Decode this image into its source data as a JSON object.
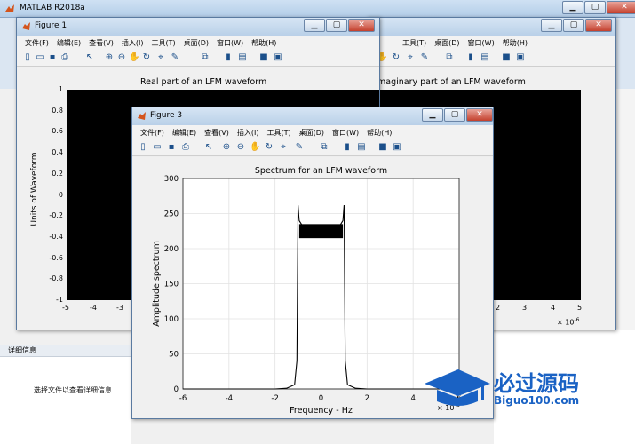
{
  "main": {
    "title": "MATLAB R2018a",
    "detail_header": "详细信息",
    "detail_text": "选择文件以查看详细信息"
  },
  "figures": [
    {
      "title": "Figure 1",
      "menu": [
        "文件(F)",
        "编辑(E)",
        "查看(V)",
        "插入(I)",
        "工具(T)",
        "桌面(D)",
        "窗口(W)",
        "帮助(H)"
      ],
      "plot_title": "Real part of an LFM waveform",
      "ylabel": "Units of Waveform",
      "yticks": [
        "1",
        "0.8",
        "0.6",
        "0.4",
        "0.2",
        "0",
        "-0.2",
        "-0.4",
        "-0.6",
        "-0.8",
        "-1"
      ],
      "xticks": [
        "-5",
        "-4",
        "-3"
      ]
    },
    {
      "title": "Figure 2",
      "menu": [
        "工具(T)",
        "桌面(D)",
        "窗口(W)",
        "帮助(H)"
      ],
      "plot_title": "maginary part of an LFM waveform",
      "xticks": [
        "2",
        "3",
        "4",
        "5"
      ],
      "xexp": "× 10",
      "xexp_power": "-6"
    },
    {
      "title": "Figure 3",
      "menu": [
        "文件(F)",
        "编辑(E)",
        "查看(V)",
        "插入(I)",
        "工具(T)",
        "桌面(D)",
        "窗口(W)",
        "帮助(H)"
      ]
    }
  ],
  "chart_data": {
    "type": "line",
    "title": "Spectrum for an LFM waveform",
    "xlabel": "Frequency - Hz",
    "ylabel": "Amplitude spectrum",
    "x_exponent": "8",
    "xlim": [
      -6,
      6
    ],
    "ylim": [
      0,
      300
    ],
    "xticks": [
      "-6",
      "-4",
      "-2",
      "0",
      "2",
      "4",
      "6"
    ],
    "yticks": [
      "0",
      "50",
      "100",
      "150",
      "200",
      "250",
      "300"
    ],
    "grid": true,
    "series": [
      {
        "x": [
          -6,
          -2,
          -1.5,
          -1.15,
          -1.05,
          -1.0,
          -0.95,
          -0.8,
          -0.5,
          0,
          0.5,
          0.8,
          0.95,
          1.0,
          1.05,
          1.15,
          1.5,
          2,
          6
        ],
        "values": [
          0,
          0,
          1,
          6,
          40,
          262,
          240,
          232,
          226,
          224,
          226,
          232,
          240,
          262,
          40,
          6,
          1,
          0,
          0
        ]
      }
    ],
    "band": {
      "x_range": [
        -0.95,
        0.95
      ],
      "lower": 215,
      "upper": 235
    },
    "color": "#000000"
  },
  "watermark": {
    "brand": "必过源码",
    "site": "Biguo100.com"
  },
  "colors": {
    "titlebar": "#c4d7ec",
    "close": "#c4402d",
    "plot_bg": "#ffffff",
    "dark_fill": "#000000"
  }
}
